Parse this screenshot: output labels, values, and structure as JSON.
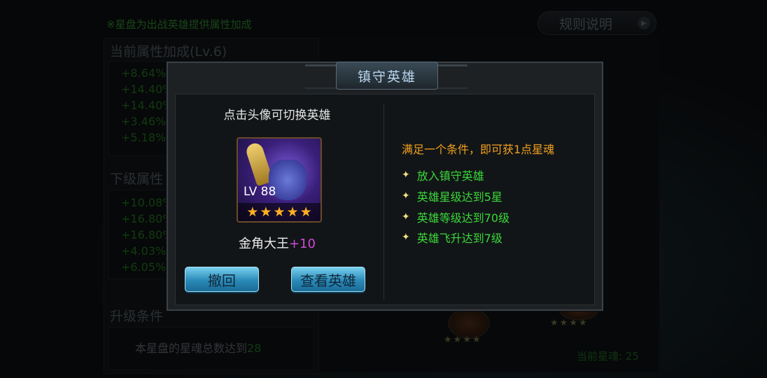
{
  "background": {
    "tip": "※星盘为出战英雄提供属性加成",
    "rules_button": "规则说明",
    "current_bonus_title": "当前属性加成(Lv.6)",
    "current_bonus_values": [
      "+8.64%",
      "+14.40%",
      "+14.40%",
      "+3.46%",
      "+5.18%"
    ],
    "next_level_title": "下级属性",
    "next_level_values": [
      "+10.08%",
      "+16.80%",
      "+16.80%",
      "+4.03%",
      "+6.05%"
    ],
    "upgrade_title": "升级条件",
    "upgrade_condition_prefix": "本星盘的星魂总数达到",
    "upgrade_condition_value": "28",
    "current_soul": "当前星魂: 25"
  },
  "dialog": {
    "title": "镇守英雄",
    "hint": "点击头像可切换英雄",
    "hero": {
      "level": "LV 88",
      "stars": 5,
      "name": "金角大王",
      "plus": "+10"
    },
    "withdraw_button": "撤回",
    "view_hero_button": "查看英雄",
    "requirements_title": "满足一个条件，即可获1点星魂",
    "requirements": [
      "放入镇守英雄",
      "英雄星级达到5星",
      "英雄等级达到70级",
      "英雄飞升达到7级"
    ]
  },
  "colors": {
    "accent_green": "#3ad83a",
    "accent_orange": "#f0a020",
    "plus_purple": "#d04ad8",
    "button_blue": "#2a8ab8"
  }
}
